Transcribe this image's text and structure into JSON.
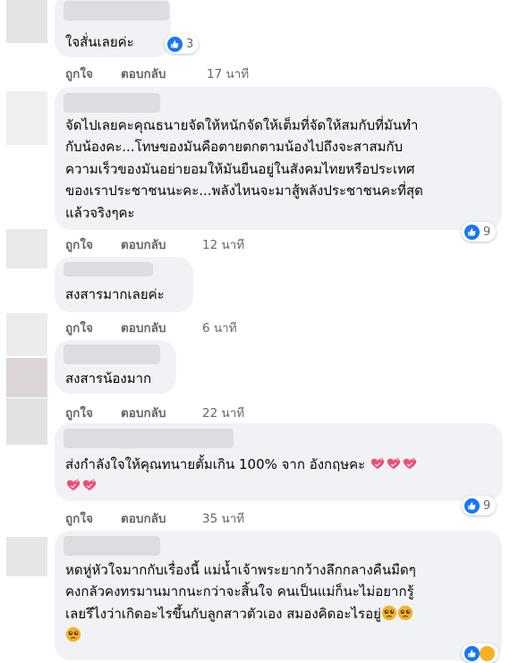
{
  "actions": {
    "like": "ถูกใจ",
    "reply": "ตอบกลับ"
  },
  "comments": [
    {
      "lines": [
        "ใจสั่นเลยค่ะ"
      ],
      "time": "17 นาที",
      "reactions": "3"
    },
    {
      "lines": [
        "จัดไปเลยคะคุณธนายจัดให้หนักจัดให้เต็มที่จัดให้สมกับที่มันทำ",
        "กับน้องคะ...โทษของมันคือตายตกตามน้องไปถึงจะสาสมกับ",
        "ความเร็วของมันอย่ายอมให้มันยืนอยู่ในสังคมไทยหรือประเทศ",
        "ของเราประชาชนนะคะ...พลังไหนจะมาสู้พลังประชาชนคะที่สุด",
        "แล้วจริงๆคะ"
      ],
      "time": "12 นาที",
      "reactions": "9"
    },
    {
      "lines": [
        "สงสารมากเลยค่ะ"
      ],
      "time": "6 นาที"
    },
    {
      "lines": [
        "สงสารน้องมาก"
      ],
      "time": "22 นาที"
    },
    {
      "lines": [
        "ส่งกำลังใจให้คุณทนายตั้มเกิน 100% จาก อังกฤษคะ"
      ],
      "time": "35 นาที",
      "reactions": "9"
    },
    {
      "lines": [
        "หดหู่หัวใจมากกับเรื่องนี้ แม่น้ำเจ้าพระยากว้างลึกกลางคืนมืดๆ",
        "คงกลัวคงทรมานมากนะกว่าจะสิ้นใจ คนเป็นแม่ก็นะไม่อยากรู้",
        "เลยรึไงว่าเกิดอะไรขึ้นกับลูกสาวตัวเอง สมองคิดอะไรอยู่"
      ]
    }
  ]
}
